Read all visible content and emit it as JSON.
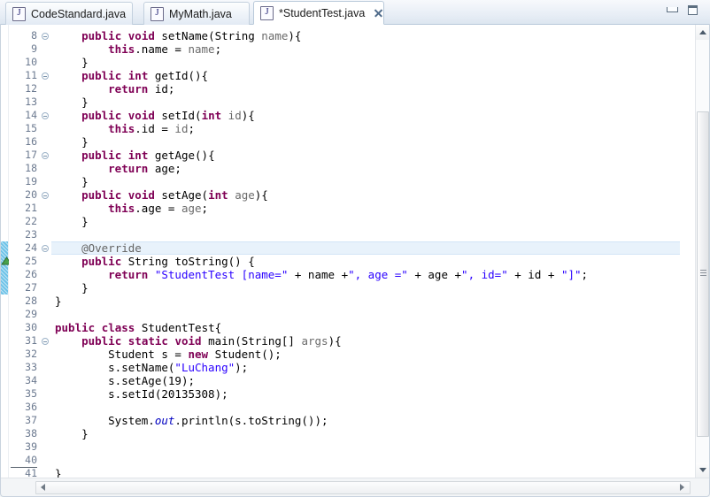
{
  "window": {
    "minimize_label": "Minimize",
    "maximize_label": "Maximize"
  },
  "tabs": [
    {
      "label": "CodeStandard.java",
      "icon": "java-file-icon",
      "active": false,
      "dirty": false
    },
    {
      "label": "MyMath.java",
      "icon": "java-file-icon",
      "active": false,
      "dirty": false
    },
    {
      "label": "*StudentTest.java",
      "icon": "java-file-icon",
      "active": true,
      "dirty": true
    }
  ],
  "editor": {
    "first_visible_line": 8,
    "last_visible_line": 41,
    "highlighted_line": 24,
    "fold_lines": [
      8,
      11,
      14,
      17,
      20,
      24,
      31
    ],
    "underlined_line_numbers": [
      40,
      41
    ],
    "change_bar_lines": [
      24,
      25,
      26,
      27
    ],
    "override_marker_line": 25,
    "colors": {
      "keyword": "#7f0055",
      "string": "#2a00ff",
      "annotation": "#646464",
      "static_field": "#0000c0",
      "parameter": "#6a6a6a",
      "line_number": "#6c7a90",
      "current_line_highlight": "#e8f2fb",
      "change_bar": "#6fc3e8",
      "background": "#ffffff"
    },
    "lines": [
      {
        "n": 8,
        "indent": 4,
        "tokens": [
          {
            "t": "public",
            "c": "kw"
          },
          {
            "t": " ",
            "c": ""
          },
          {
            "t": "void",
            "c": "kw"
          },
          {
            "t": " setName(",
            "c": ""
          },
          {
            "t": "String",
            "c": ""
          },
          {
            "t": " ",
            "c": ""
          },
          {
            "t": "name",
            "c": "prm"
          },
          {
            "t": "){",
            "c": ""
          }
        ]
      },
      {
        "n": 9,
        "indent": 8,
        "tokens": [
          {
            "t": "this",
            "c": "kw"
          },
          {
            "t": ".name = ",
            "c": ""
          },
          {
            "t": "name",
            "c": "prm"
          },
          {
            "t": ";",
            "c": ""
          }
        ]
      },
      {
        "n": 10,
        "indent": 4,
        "tokens": [
          {
            "t": "}",
            "c": ""
          }
        ]
      },
      {
        "n": 11,
        "indent": 4,
        "tokens": [
          {
            "t": "public",
            "c": "kw"
          },
          {
            "t": " ",
            "c": ""
          },
          {
            "t": "int",
            "c": "kw"
          },
          {
            "t": " getId(){",
            "c": ""
          }
        ]
      },
      {
        "n": 12,
        "indent": 8,
        "tokens": [
          {
            "t": "return",
            "c": "kw"
          },
          {
            "t": " id;",
            "c": ""
          }
        ]
      },
      {
        "n": 13,
        "indent": 4,
        "tokens": [
          {
            "t": "}",
            "c": ""
          }
        ]
      },
      {
        "n": 14,
        "indent": 4,
        "tokens": [
          {
            "t": "public",
            "c": "kw"
          },
          {
            "t": " ",
            "c": ""
          },
          {
            "t": "void",
            "c": "kw"
          },
          {
            "t": " setId(",
            "c": ""
          },
          {
            "t": "int",
            "c": "kw"
          },
          {
            "t": " ",
            "c": ""
          },
          {
            "t": "id",
            "c": "prm"
          },
          {
            "t": "){",
            "c": ""
          }
        ]
      },
      {
        "n": 15,
        "indent": 8,
        "tokens": [
          {
            "t": "this",
            "c": "kw"
          },
          {
            "t": ".id = ",
            "c": ""
          },
          {
            "t": "id",
            "c": "prm"
          },
          {
            "t": ";",
            "c": ""
          }
        ]
      },
      {
        "n": 16,
        "indent": 4,
        "tokens": [
          {
            "t": "}",
            "c": ""
          }
        ]
      },
      {
        "n": 17,
        "indent": 4,
        "tokens": [
          {
            "t": "public",
            "c": "kw"
          },
          {
            "t": " ",
            "c": ""
          },
          {
            "t": "int",
            "c": "kw"
          },
          {
            "t": " getAge(){",
            "c": ""
          }
        ]
      },
      {
        "n": 18,
        "indent": 8,
        "tokens": [
          {
            "t": "return",
            "c": "kw"
          },
          {
            "t": " age;",
            "c": ""
          }
        ]
      },
      {
        "n": 19,
        "indent": 4,
        "tokens": [
          {
            "t": "}",
            "c": ""
          }
        ]
      },
      {
        "n": 20,
        "indent": 4,
        "tokens": [
          {
            "t": "public",
            "c": "kw"
          },
          {
            "t": " ",
            "c": ""
          },
          {
            "t": "void",
            "c": "kw"
          },
          {
            "t": " setAge(",
            "c": ""
          },
          {
            "t": "int",
            "c": "kw"
          },
          {
            "t": " ",
            "c": ""
          },
          {
            "t": "age",
            "c": "prm"
          },
          {
            "t": "){",
            "c": ""
          }
        ]
      },
      {
        "n": 21,
        "indent": 8,
        "tokens": [
          {
            "t": "this",
            "c": "kw"
          },
          {
            "t": ".age = ",
            "c": ""
          },
          {
            "t": "age",
            "c": "prm"
          },
          {
            "t": ";",
            "c": ""
          }
        ]
      },
      {
        "n": 22,
        "indent": 4,
        "tokens": [
          {
            "t": "}",
            "c": ""
          }
        ]
      },
      {
        "n": 23,
        "indent": 0,
        "tokens": []
      },
      {
        "n": 24,
        "indent": 4,
        "tokens": [
          {
            "t": "@Override",
            "c": "ann"
          }
        ]
      },
      {
        "n": 25,
        "indent": 4,
        "tokens": [
          {
            "t": "public",
            "c": "kw"
          },
          {
            "t": " String toString() {",
            "c": ""
          }
        ]
      },
      {
        "n": 26,
        "indent": 8,
        "tokens": [
          {
            "t": "return",
            "c": "kw"
          },
          {
            "t": " ",
            "c": ""
          },
          {
            "t": "\"StudentTest [name=\"",
            "c": "str"
          },
          {
            "t": " + name +",
            "c": ""
          },
          {
            "t": "\", age =\"",
            "c": "str"
          },
          {
            "t": " + age +",
            "c": ""
          },
          {
            "t": "\", id=\"",
            "c": "str"
          },
          {
            "t": " + id + ",
            "c": ""
          },
          {
            "t": "\"]\"",
            "c": "str"
          },
          {
            "t": ";",
            "c": ""
          }
        ]
      },
      {
        "n": 27,
        "indent": 4,
        "tokens": [
          {
            "t": "}",
            "c": ""
          }
        ]
      },
      {
        "n": 28,
        "indent": 0,
        "tokens": [
          {
            "t": "}",
            "c": ""
          }
        ]
      },
      {
        "n": 29,
        "indent": 0,
        "tokens": []
      },
      {
        "n": 30,
        "indent": 0,
        "tokens": [
          {
            "t": "public",
            "c": "kw"
          },
          {
            "t": " ",
            "c": ""
          },
          {
            "t": "class",
            "c": "kw"
          },
          {
            "t": " StudentTest{",
            "c": ""
          }
        ]
      },
      {
        "n": 31,
        "indent": 4,
        "tokens": [
          {
            "t": "public",
            "c": "kw"
          },
          {
            "t": " ",
            "c": ""
          },
          {
            "t": "static",
            "c": "kw"
          },
          {
            "t": " ",
            "c": ""
          },
          {
            "t": "void",
            "c": "kw"
          },
          {
            "t": " main(String[] ",
            "c": ""
          },
          {
            "t": "args",
            "c": "prm"
          },
          {
            "t": "){",
            "c": ""
          }
        ]
      },
      {
        "n": 32,
        "indent": 8,
        "tokens": [
          {
            "t": "Student s = ",
            "c": ""
          },
          {
            "t": "new",
            "c": "kw"
          },
          {
            "t": " Student();",
            "c": ""
          }
        ]
      },
      {
        "n": 33,
        "indent": 8,
        "tokens": [
          {
            "t": "s.setName(",
            "c": ""
          },
          {
            "t": "\"LuChang\"",
            "c": "str"
          },
          {
            "t": ");",
            "c": ""
          }
        ]
      },
      {
        "n": 34,
        "indent": 8,
        "tokens": [
          {
            "t": "s.setAge(19);",
            "c": ""
          }
        ]
      },
      {
        "n": 35,
        "indent": 8,
        "tokens": [
          {
            "t": "s.setId(20135308);",
            "c": ""
          }
        ]
      },
      {
        "n": 36,
        "indent": 0,
        "tokens": []
      },
      {
        "n": 37,
        "indent": 8,
        "tokens": [
          {
            "t": "System.",
            "c": ""
          },
          {
            "t": "out",
            "c": "stat"
          },
          {
            "t": ".println(s.toString());",
            "c": ""
          }
        ]
      },
      {
        "n": 38,
        "indent": 4,
        "tokens": [
          {
            "t": "}",
            "c": ""
          }
        ]
      },
      {
        "n": 39,
        "indent": 0,
        "tokens": []
      },
      {
        "n": 40,
        "indent": 0,
        "tokens": []
      },
      {
        "n": 41,
        "indent": 0,
        "tokens": [
          {
            "t": "}",
            "c": ""
          }
        ]
      }
    ]
  },
  "scrollbars": {
    "vertical": {
      "up_label": "Scroll up",
      "down_label": "Scroll down",
      "thumb_label": "Vertical scroll thumb"
    },
    "horizontal": {
      "left_label": "Scroll left",
      "right_label": "Scroll right",
      "thumb_label": "Horizontal scroll thumb"
    }
  }
}
